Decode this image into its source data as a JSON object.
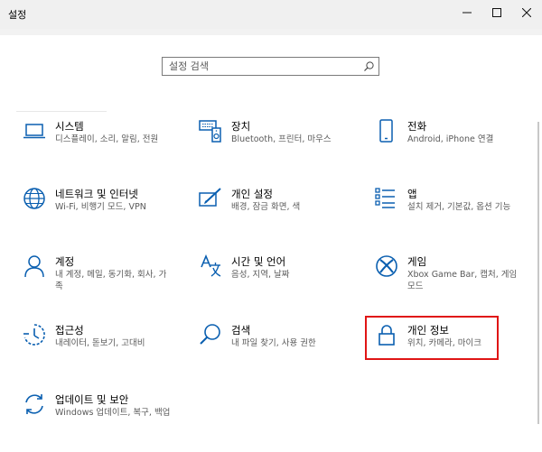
{
  "window": {
    "title": "설정",
    "minimize_icon": "minimize-icon",
    "maximize_icon": "maximize-icon",
    "close_icon": "close-icon"
  },
  "search": {
    "placeholder": "설정 검색",
    "icon": "search-icon"
  },
  "tiles": [
    {
      "title": "시스템",
      "desc": "디스플레이, 소리, 알림, 전원",
      "icon": "laptop-icon"
    },
    {
      "title": "장치",
      "desc": "Bluetooth, 프린터, 마우스",
      "icon": "devices-icon"
    },
    {
      "title": "전화",
      "desc": "Android, iPhone 연결",
      "icon": "phone-icon"
    },
    {
      "title": "네트워크 및 인터넷",
      "desc": "Wi-Fi, 비행기 모드, VPN",
      "icon": "globe-icon"
    },
    {
      "title": "개인 설정",
      "desc": "배경, 잠금 화면, 색",
      "icon": "personalization-icon"
    },
    {
      "title": "앱",
      "desc": "설치 제거, 기본값, 옵션 기능",
      "icon": "apps-list-icon"
    },
    {
      "title": "계정",
      "desc": "내 계정, 메일, 동기화, 회사, 가족",
      "icon": "person-icon"
    },
    {
      "title": "시간 및 언어",
      "desc": "음성, 지역, 날짜",
      "icon": "time-language-icon"
    },
    {
      "title": "게임",
      "desc": "Xbox Game Bar, 캡처, 게임 모드",
      "icon": "xbox-icon"
    },
    {
      "title": "접근성",
      "desc": "내레이터, 돋보기, 고대비",
      "icon": "ease-of-access-icon"
    },
    {
      "title": "검색",
      "desc": "내 파일 찾기, 사용 권한",
      "icon": "magnifier-icon"
    },
    {
      "title": "개인 정보",
      "desc": "위치, 카메라, 마이크",
      "icon": "lock-icon"
    },
    {
      "title": "업데이트 및 보안",
      "desc": "Windows 업데이트, 복구, 백업",
      "icon": "sync-icon"
    }
  ],
  "highlight_color": "#e01515",
  "accent_color": "#0a5fb0"
}
